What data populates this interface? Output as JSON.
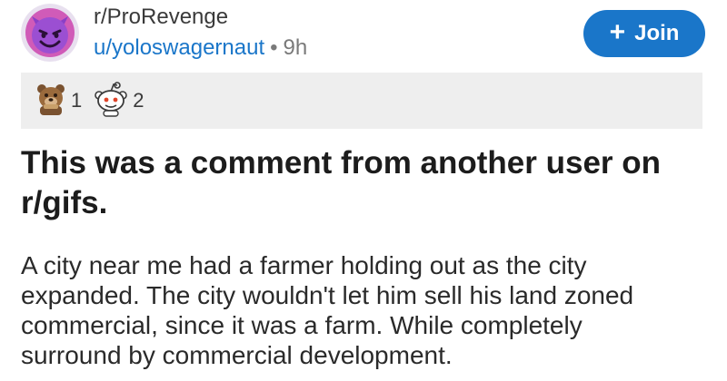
{
  "header": {
    "subreddit": "r/ProRevenge",
    "username": "u/yoloswagernaut",
    "separator": "•",
    "age": "9h",
    "avatar_icon": "devil-emoji-icon",
    "avatar_color": "#8a3fc6"
  },
  "join_button": {
    "icon": "plus-icon",
    "label": "Join",
    "color": "#1a76c9"
  },
  "awards": [
    {
      "icon": "bear-award-icon",
      "count": "1"
    },
    {
      "icon": "snoo-award-icon",
      "count": "2"
    }
  ],
  "post": {
    "title": "This was a comment from another user on r/gifs.",
    "body_lines": [
      "A city near me had a farmer holding out as the city",
      "expanded.   The city wouldn't let him sell his land zoned",
      "commercial, since it was a farm.   While completely",
      "surround by commercial development."
    ]
  }
}
